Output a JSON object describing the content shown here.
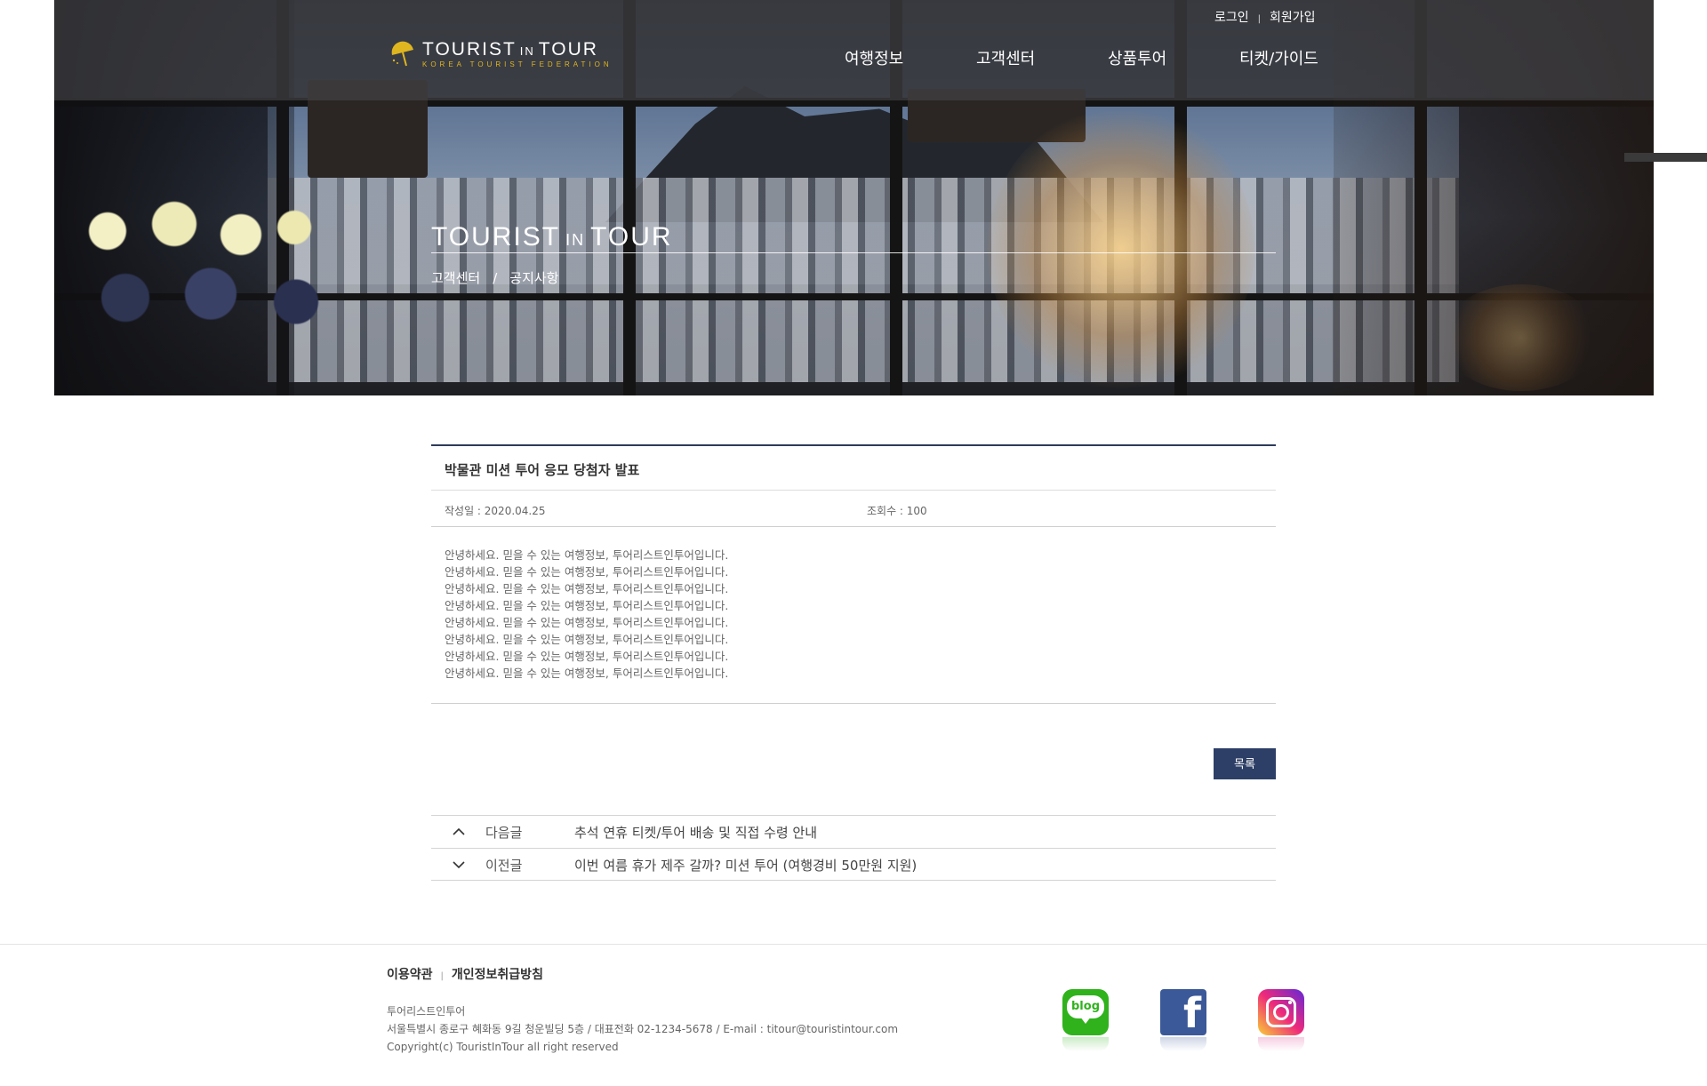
{
  "header": {
    "logo": {
      "title_main": "TOURIST",
      "title_in": "IN",
      "title_end": "TOUR",
      "subtitle": "KOREA TOURIST FEDERATION"
    },
    "util": {
      "login": "로그인",
      "sep": "|",
      "join": "회원가입"
    },
    "gnb": [
      "여행정보",
      "고객센터",
      "상품투어",
      "티켓/가이드"
    ]
  },
  "hero": {
    "title_main": "TOURIST",
    "title_in": "IN",
    "title_end": "TOUR",
    "breadcrumb": [
      "고객센터",
      "/",
      "공지사항"
    ]
  },
  "post": {
    "subject": "박물관 미션 투어 응모 당첨자 발표",
    "date_label": "작성일 : 2020.04.25",
    "views_label": "조회수 : 100",
    "body_lines": [
      "안녕하세요. 믿을 수 있는 여행정보, 투어리스트인투어입니다.",
      "안녕하세요. 믿을 수 있는 여행정보, 투어리스트인투어입니다.",
      "안녕하세요. 믿을 수 있는 여행정보, 투어리스트인투어입니다.",
      "안녕하세요. 믿을 수 있는 여행정보, 투어리스트인투어입니다.",
      "안녕하세요. 믿을 수 있는 여행정보, 투어리스트인투어입니다.",
      "안녕하세요. 믿을 수 있는 여행정보, 투어리스트인투어입니다.",
      "안녕하세요. 믿을 수 있는 여행정보, 투어리스트인투어입니다.",
      "안녕하세요. 믿을 수 있는 여행정보, 투어리스트인투어입니다."
    ],
    "list_button": "목록"
  },
  "nav": {
    "next": {
      "kind": "다음글",
      "title": "추석 연휴 티켓/투어 배송 및 직접 수령 안내",
      "icon": "chevron-up-icon"
    },
    "prev": {
      "kind": "이전글",
      "title": "이번 여름 휴가 제주 갈까? 미션 투어 (여행경비 50만원 지원)",
      "icon": "chevron-down-icon"
    }
  },
  "footer": {
    "menu": [
      "이용약관",
      "|",
      "개인정보취급방침"
    ],
    "company": "투어리스트인투어",
    "address": "서울특별시 종로구 혜화동 9길 청운빌딩 5층 / 대표전화 02-1234-5678 / E-mail : titour@touristintour.com",
    "copyright": "Copyright(c) TouristInTour all right reserved",
    "sns": [
      {
        "name": "blog",
        "label": "blog",
        "color": "#2fb21c"
      },
      {
        "name": "facebook",
        "label": "f",
        "color": "#3b5998"
      },
      {
        "name": "instagram",
        "color": "#e1306c"
      }
    ]
  },
  "colors": {
    "accent_navy": "#2d3f66",
    "logo_gold": "#e0b620"
  }
}
